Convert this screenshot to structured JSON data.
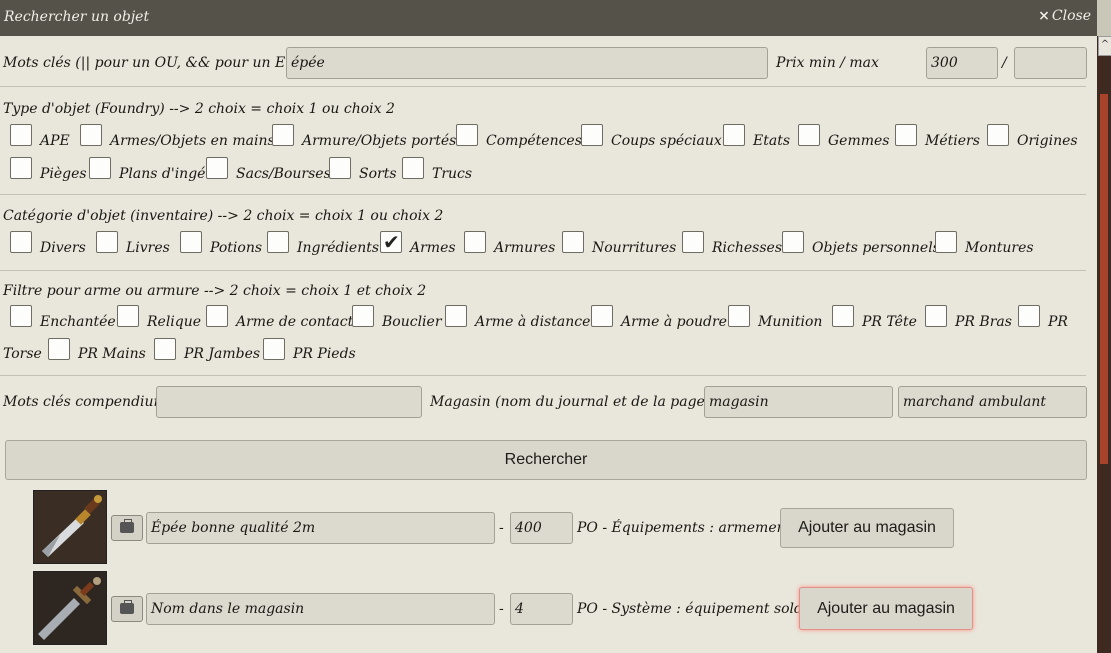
{
  "window": {
    "title": "Rechercher un objet",
    "close_label": "Close",
    "close_icon": "×"
  },
  "sidebar": {
    "tab_icon": "^"
  },
  "keywords": {
    "label": "Mots clés (|| pour un OU, && pour un ET )",
    "value": "épée"
  },
  "price": {
    "label": "Prix min / max",
    "min": "300",
    "separator": "/",
    "max": ""
  },
  "type_section": {
    "heading": "Type d'objet (Foundry) --> 2 choix = choix 1 ou choix 2",
    "options": [
      {
        "label": "APE",
        "checked": false
      },
      {
        "label": "Armes/Objets en mains",
        "checked": false
      },
      {
        "label": "Armure/Objets portés",
        "checked": false
      },
      {
        "label": "Compétences",
        "checked": false
      },
      {
        "label": "Coups spéciaux",
        "checked": false
      },
      {
        "label": "Etats",
        "checked": false
      },
      {
        "label": "Gemmes",
        "checked": false
      },
      {
        "label": "Métiers",
        "checked": false
      },
      {
        "label": "Origines",
        "checked": false
      },
      {
        "label": "Pièges",
        "checked": false
      },
      {
        "label": "Plans d'ingé",
        "checked": false
      },
      {
        "label": "Sacs/Bourses",
        "checked": false
      },
      {
        "label": "Sorts",
        "checked": false
      },
      {
        "label": "Trucs",
        "checked": false
      }
    ]
  },
  "category_section": {
    "heading": "Catégorie d'objet (inventaire) --> 2 choix = choix 1 ou choix 2",
    "options": [
      {
        "label": "Divers",
        "checked": false
      },
      {
        "label": "Livres",
        "checked": false
      },
      {
        "label": "Potions",
        "checked": false
      },
      {
        "label": "Ingrédients",
        "checked": false
      },
      {
        "label": "Armes",
        "checked": true
      },
      {
        "label": "Armures",
        "checked": false
      },
      {
        "label": "Nourritures",
        "checked": false
      },
      {
        "label": "Richesses",
        "checked": false
      },
      {
        "label": "Objets personnels",
        "checked": false
      },
      {
        "label": "Montures",
        "checked": false
      }
    ]
  },
  "filter_section": {
    "heading": "Filtre pour arme ou armure --> 2 choix = choix 1 et choix 2",
    "options": [
      {
        "label": "Enchantée",
        "checked": false
      },
      {
        "label": "Relique",
        "checked": false
      },
      {
        "label": "Arme de contact",
        "checked": false
      },
      {
        "label": "Bouclier",
        "checked": false
      },
      {
        "label": "Arme à distance",
        "checked": false
      },
      {
        "label": "Arme à poudre",
        "checked": false
      },
      {
        "label": "Munition",
        "checked": false
      },
      {
        "label": "PR Tête",
        "checked": false
      },
      {
        "label": "PR Bras",
        "checked": false
      },
      {
        "label": "PR",
        "checked": false
      },
      {
        "label": "Torse",
        "checked": false
      },
      {
        "label": "PR Mains",
        "checked": false
      },
      {
        "label": "PR Jambes",
        "checked": false
      },
      {
        "label": "PR Pieds",
        "checked": false
      }
    ]
  },
  "compendium": {
    "label": "Mots clés compendium",
    "value": ""
  },
  "shop": {
    "label": "Magasin (nom du journal et de la page)",
    "journal": "magasin",
    "page": "marchand ambulant"
  },
  "search_button": "Rechercher",
  "results": [
    {
      "image_icon": "sword-icon",
      "bag_icon": "bag-icon",
      "name": "Épée bonne qualité 2m",
      "dash": "-",
      "price": "400",
      "info": "PO - Équipements : armement",
      "button": "Ajouter au magasin"
    },
    {
      "image_icon": "sword-icon",
      "bag_icon": "bag-icon",
      "name": "Nom dans le magasin",
      "dash": "-",
      "price": "4",
      "info": "PO - Système : équipement soldat",
      "button": "Ajouter au magasin"
    }
  ]
}
